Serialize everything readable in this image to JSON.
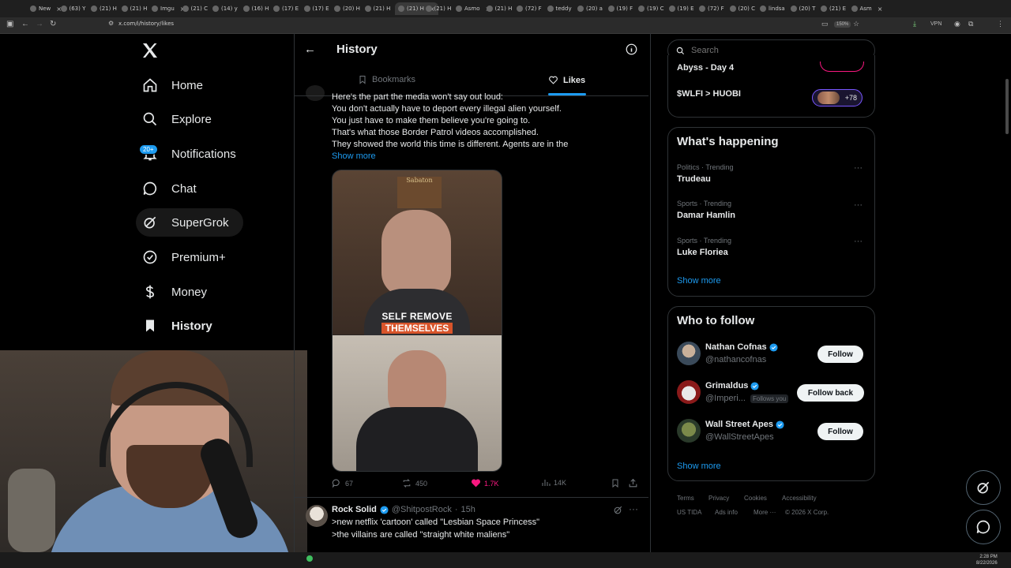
{
  "browser": {
    "tabs": [
      {
        "label": "New"
      },
      {
        "label": "(63) Y"
      },
      {
        "label": "(21) H"
      },
      {
        "label": "(21) H"
      },
      {
        "label": "Imgu"
      },
      {
        "label": "(21) C"
      },
      {
        "label": "(14) y"
      },
      {
        "label": "(16) H"
      },
      {
        "label": "(17) E"
      },
      {
        "label": "(17) E"
      },
      {
        "label": "(20) H"
      },
      {
        "label": "(21) H"
      },
      {
        "label": "(21) H",
        "active": true
      },
      {
        "label": "(21) H"
      },
      {
        "label": "Asmo"
      },
      {
        "label": "(21) H"
      },
      {
        "label": "(72) F"
      },
      {
        "label": "teddy"
      },
      {
        "label": "(20) a"
      },
      {
        "label": "(19) F"
      },
      {
        "label": "(19) C"
      },
      {
        "label": "(19) E"
      },
      {
        "label": "(72) F"
      },
      {
        "label": "(20) C"
      },
      {
        "label": "lindsa"
      },
      {
        "label": "(20) T"
      },
      {
        "label": "(21) E"
      },
      {
        "label": "Asm"
      }
    ],
    "url": "x.com/i/history/likes",
    "zoom": "150%",
    "vpn_label": "VPN"
  },
  "nav": {
    "logo": "X",
    "items": [
      {
        "label": "Home",
        "icon": "home-icon"
      },
      {
        "label": "Explore",
        "icon": "search-icon"
      },
      {
        "label": "Notifications",
        "icon": "bell-icon",
        "badge": "20+"
      },
      {
        "label": "Chat",
        "icon": "chat-bubble-icon"
      },
      {
        "label": "SuperGrok",
        "icon": "grok-icon"
      },
      {
        "label": "Premium+",
        "icon": "verified-badge-icon"
      },
      {
        "label": "Money",
        "icon": "dollar-icon"
      },
      {
        "label": "History",
        "icon": "bookmark-filled-icon"
      }
    ]
  },
  "header": {
    "title": "History",
    "tabs": [
      {
        "label": "Bookmarks",
        "active": false
      },
      {
        "label": "Likes",
        "active": true
      }
    ]
  },
  "tweet1": {
    "lines": [
      "Here's the part the media won't say out loud:",
      "You don't actually have to deport every illegal alien yourself.",
      "You just have to make them believe you're going to.",
      "That's what those Border Patrol videos accomplished.",
      "They showed the world this time is different. Agents are in the"
    ],
    "show_more": "Show more",
    "video_caption_1": "SELF REMOVE",
    "video_caption_2": "THEMSELVES",
    "poster_text": "Sabaton",
    "replies": "67",
    "reposts": "450",
    "likes": "1.7K",
    "views": "14K"
  },
  "tweet2": {
    "name": "Rock Solid",
    "handle": "@ShitpostRock",
    "time": "15h",
    "sep": "·",
    "lines": [
      ">new netflix 'cartoon' called \"Lesbian Space Princess\"",
      ">the villains are called \"straight white maliens\""
    ]
  },
  "right": {
    "search_placeholder": "Search",
    "spaces": [
      {
        "title": "Abyss - Day 4"
      },
      {
        "title": "$WLFI > HUOBI",
        "count": "+78"
      }
    ],
    "happening": {
      "title": "What's happening",
      "trends": [
        {
          "meta": "Politics · Trending",
          "name": "Trudeau"
        },
        {
          "meta": "Sports · Trending",
          "name": "Damar Hamlin"
        },
        {
          "meta": "Sports · Trending",
          "name": "Luke Floriea"
        }
      ],
      "show_more": "Show more"
    },
    "who_to_follow": {
      "title": "Who to follow",
      "accounts": [
        {
          "name": "Nathan Cofnas",
          "handle": "@nathancofnas",
          "button": "Follow"
        },
        {
          "name": "Grimaldus",
          "handle": "@Imperi...",
          "follows_you": "Follows you",
          "button": "Follow back"
        },
        {
          "name": "Wall Street Apes",
          "handle": "@WallStreetApes",
          "button": "Follow"
        }
      ],
      "show_more": "Show more"
    },
    "footer": {
      "links": [
        "Terms",
        "Privacy",
        "Cookies",
        "Accessibility",
        "US TIDA",
        "Ads info",
        "More ···"
      ],
      "copyright": "© 2026 X Corp."
    }
  },
  "taskbar": {
    "time": "2:28 PM",
    "date": "8/22/2026"
  },
  "colors": {
    "accent": "#1d9bf0",
    "like": "#f91880",
    "bg": "#000000",
    "border": "#2f3336",
    "muted": "#71767b"
  }
}
